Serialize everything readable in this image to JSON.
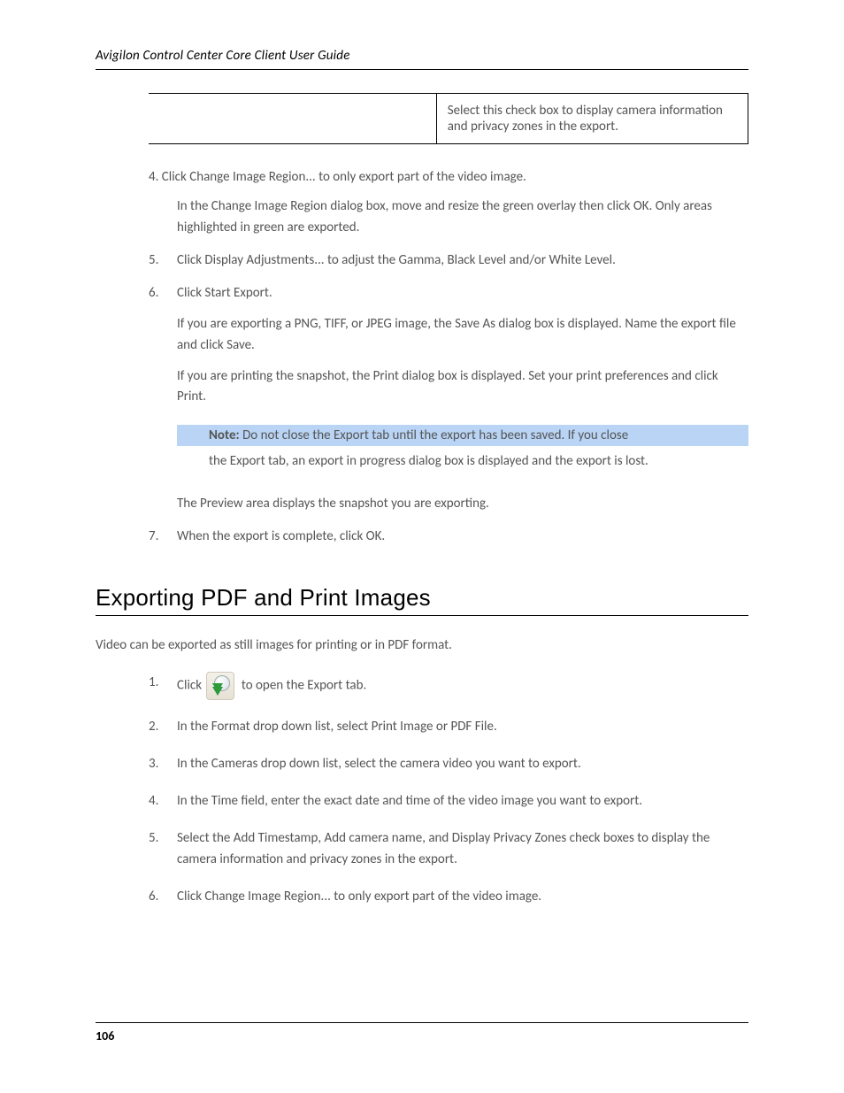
{
  "header": {
    "running": "Avigilon Control Center Core Client User Guide"
  },
  "table": {
    "leftCell": "",
    "rightCell": "Select this check box to display camera information and privacy zones in the export."
  },
  "intro": "4. Click Change Image Region... to only export part of the video image.",
  "introCont": "In the Change Image Region dialog box, move and resize the green overlay then click OK. Only areas highlighted in green are exported.",
  "steps5": {
    "num": "5.",
    "text": "Click Display Adjustments... to adjust the Gamma, Black Level and/or White Level."
  },
  "steps6": {
    "num": "6.",
    "textA": "Click Start Export.",
    "textB": "If you are exporting a PNG, TIFF, or JPEG image, the Save As dialog box is displayed. Name the export file and click Save.",
    "textC": "If you are printing the snapshot, the Print dialog box is displayed. Set your print preferences and click Print."
  },
  "note": {
    "label": "Note:",
    "head": "Do not close the Export tab until the export has been saved. If you close",
    "body": "the Export tab, an export in progress dialog box is displayed and the export is lost."
  },
  "after6": "The Preview area displays the snapshot you are exporting.",
  "step7": {
    "num": "7.",
    "text": "When the export is complete, click OK."
  },
  "sectionTitle": "Exporting PDF and Print Images",
  "pdfIntro": "Video can be exported as still images for printing or in PDF format.",
  "pdf1": {
    "num": "1.",
    "text": "Click  to open the Export tab.",
    "suffix": ""
  },
  "pdf2": {
    "num": "2.",
    "text": "In the Format drop down list, select Print Image or PDF File."
  },
  "pdf3": {
    "num": "3.",
    "text": "In the Cameras drop down list, select the camera video you want to export."
  },
  "pdf4": {
    "num": "4.",
    "text": "In the Time field, enter the exact date and time of the video image you want to export."
  },
  "pdf5": {
    "num": "5.",
    "text": "Select the Add Timestamp, Add camera name, and Display Privacy Zones check boxes to display the camera information and privacy zones in the export."
  },
  "pdf6": {
    "num": "6.",
    "text": "Click Change Image Region... to only export part of the video image."
  },
  "footer": {
    "pageNum": "106"
  }
}
